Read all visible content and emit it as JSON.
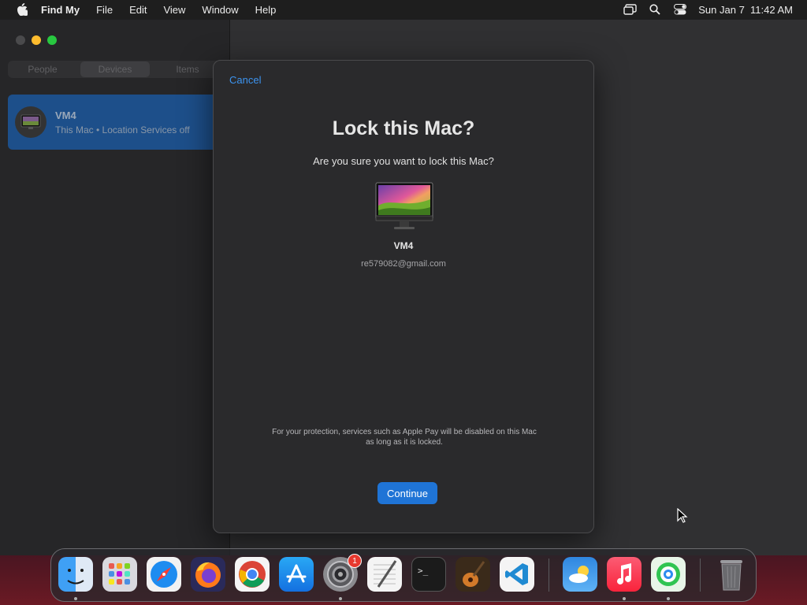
{
  "menubar": {
    "app_name": "Find My",
    "menus": [
      "File",
      "Edit",
      "View",
      "Window",
      "Help"
    ],
    "clock": "Sun Jan 7  11:42 AM"
  },
  "sidebar": {
    "tabs": [
      "People",
      "Devices",
      "Items"
    ],
    "active_tab": "Devices",
    "device": {
      "name": "VM4",
      "subtitle": "This Mac • Location Services off"
    }
  },
  "dialog": {
    "cancel_label": "Cancel",
    "title": "Lock this Mac?",
    "subtitle": "Are you sure you want to lock this Mac?",
    "device_name": "VM4",
    "email": "re579082@gmail.com",
    "note": "For your protection, services such as Apple Pay will be disabled on this Mac as long as it is locked.",
    "continue_label": "Continue"
  },
  "dock": {
    "apps": [
      "finder-icon",
      "launchpad-icon",
      "safari-icon",
      "firefox-icon",
      "chrome-icon",
      "app-store-icon",
      "system-settings-icon",
      "textedit-icon",
      "terminal-icon",
      "garageband-icon",
      "vscode-icon",
      "weather-icon",
      "music-icon",
      "find-my-icon",
      "trash-icon"
    ],
    "settings_badge": "1"
  },
  "colors": {
    "accent": "#1f74d6",
    "link": "#3c94f0",
    "selection": "#1d4f8a"
  }
}
